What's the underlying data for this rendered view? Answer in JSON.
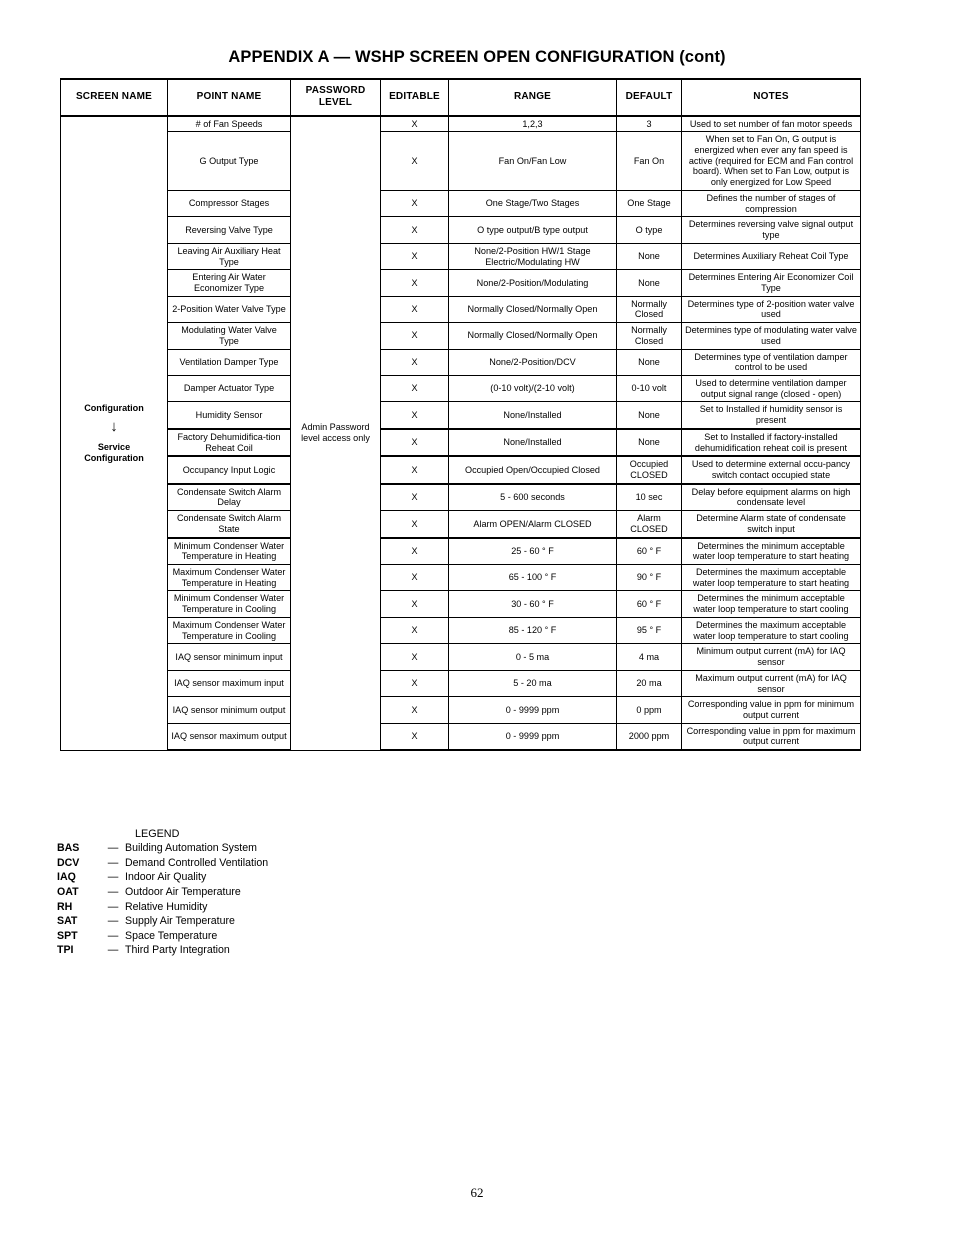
{
  "document": {
    "title": "APPENDIX A — WSHP SCREEN OPEN CONFIGURATION (cont)",
    "page_number": "62"
  },
  "table": {
    "headers": [
      "SCREEN NAME",
      "POINT NAME",
      "PASSWORD LEVEL",
      "EDITABLE",
      "RANGE",
      "DEFAULT",
      "NOTES"
    ],
    "header_password_line1": "PASSWORD",
    "header_password_line2": "LEVEL",
    "screen_name": {
      "line1": "Configuration",
      "arrow": "↓",
      "line2": "Service",
      "line3": "Configuration"
    },
    "password_level": "Admin Password level access only",
    "rows": [
      {
        "point_name": "# of Fan Speeds",
        "editable": "X",
        "range": "1,2,3",
        "default": "3",
        "notes": "Used to set number of fan motor speeds",
        "section_top": false
      },
      {
        "point_name": "G Output Type",
        "editable": "X",
        "range": "Fan On/Fan Low",
        "default": "Fan On",
        "notes": "When set to Fan On, G output is energized when ever any fan speed is active (required for ECM and Fan control board). When set to Fan Low, output is only energized for Low Speed",
        "section_top": false
      },
      {
        "point_name": "Compressor Stages",
        "editable": "X",
        "range": "One Stage/Two Stages",
        "default": "One Stage",
        "notes": "Defines the number of stages of compression",
        "section_top": false
      },
      {
        "point_name": "Reversing Valve Type",
        "editable": "X",
        "range": "O type output/B type output",
        "default": "O type",
        "notes": "Determines reversing valve signal output type",
        "section_top": false
      },
      {
        "point_name": "Leaving Air Auxiliary Heat Type",
        "editable": "X",
        "range": "None/2-Position HW/1 Stage Electric/Modulating HW",
        "default": "None",
        "notes": "Determines Auxiliary Reheat Coil Type",
        "section_top": false
      },
      {
        "point_name": "Entering Air Water Economizer Type",
        "editable": "X",
        "range": "None/2-Position/Modulating",
        "default": "None",
        "notes": "Determines Entering Air Economizer Coil Type",
        "section_top": false
      },
      {
        "point_name": "2-Position Water Valve Type",
        "editable": "X",
        "range": "Normally Closed/Normally Open",
        "default": "Normally Closed",
        "notes": "Determines type of 2-position water valve used",
        "section_top": false
      },
      {
        "point_name": "Modulating Water Valve Type",
        "editable": "X",
        "range": "Normally Closed/Normally Open",
        "default": "Normally Closed",
        "notes": "Determines type of modulating water valve used",
        "section_top": false
      },
      {
        "point_name": "Ventilation Damper Type",
        "editable": "X",
        "range": "None/2-Position/DCV",
        "default": "None",
        "notes": "Determines type of ventilation damper control to be used",
        "section_top": false
      },
      {
        "point_name": "Damper Actuator Type",
        "editable": "X",
        "range": "(0-10 volt)/(2-10 volt)",
        "default": "0-10 volt",
        "notes": "Used to determine ventilation damper output signal range (closed - open)",
        "section_top": false
      },
      {
        "point_name": "Humidity Sensor",
        "editable": "X",
        "range": "None/Installed",
        "default": "None",
        "notes": "Set to Installed if humidity sensor is present",
        "section_top": false
      },
      {
        "point_name": "Factory Dehumidifica-tion Reheat Coil",
        "editable": "X",
        "range": "None/Installed",
        "default": "None",
        "notes": "Set to Installed if factory-installed dehumidification reheat coil is present",
        "section_top": true
      },
      {
        "point_name": "Occupancy Input Logic",
        "editable": "X",
        "range": "Occupied Open/Occupied Closed",
        "default": "Occupied CLOSED",
        "notes": "Used to determine external occu-pancy switch contact occupied state",
        "section_top": true
      },
      {
        "point_name": "Condensate Switch Alarm Delay",
        "editable": "X",
        "range": "5 - 600 seconds",
        "default": "10 sec",
        "notes": "Delay before equipment alarms on high condensate level",
        "section_top": true
      },
      {
        "point_name": "Condensate Switch Alarm State",
        "editable": "X",
        "range": "Alarm OPEN/Alarm CLOSED",
        "default": "Alarm CLOSED",
        "notes": "Determine Alarm state of condensate switch input",
        "section_top": false
      },
      {
        "point_name": "Minimum Condenser Water Temperature in Heating",
        "editable": "X",
        "range": "25 - 60 ° F",
        "default": "60 ° F",
        "notes": "Determines the minimum acceptable water loop temperature to start heating",
        "section_top": true
      },
      {
        "point_name": "Maximum Condenser Water Temperature in Heating",
        "editable": "X",
        "range": "65 - 100 ° F",
        "default": "90 ° F",
        "notes": "Determines the maximum acceptable water loop temperature to start heating",
        "section_top": false
      },
      {
        "point_name": "Minimum Condenser Water Temperature in Cooling",
        "editable": "X",
        "range": "30 - 60 ° F",
        "default": "60 ° F",
        "notes": "Determines the minimum acceptable water loop temperature to start cooling",
        "section_top": false
      },
      {
        "point_name": "Maximum Condenser Water Temperature in Cooling",
        "editable": "X",
        "range": "85 - 120 ° F",
        "default": "95 ° F",
        "notes": "Determines the maximum acceptable water loop temperature to start cooling",
        "section_top": false
      },
      {
        "point_name": "IAQ sensor minimum input",
        "editable": "X",
        "range": "0 - 5 ma",
        "default": "4 ma",
        "notes": "Minimum output current (mA) for IAQ sensor",
        "section_top": false
      },
      {
        "point_name": "IAQ sensor maximum input",
        "editable": "X",
        "range": "5 - 20 ma",
        "default": "20 ma",
        "notes": "Maximum output current (mA) for IAQ sensor",
        "section_top": false
      },
      {
        "point_name": "IAQ sensor minimum output",
        "editable": "X",
        "range": "0 - 9999 ppm",
        "default": "0 ppm",
        "notes": "Corresponding value in ppm for minimum output current",
        "section_top": false
      },
      {
        "point_name": "IAQ sensor maximum output",
        "editable": "X",
        "range": "0 - 9999 ppm",
        "default": "2000 ppm",
        "notes": "Corresponding value in ppm for maximum output current",
        "section_top": false
      }
    ]
  },
  "legend": {
    "title": "LEGEND",
    "dash": "—",
    "entries": [
      {
        "abbr": "BAS",
        "term": "Building Automation System"
      },
      {
        "abbr": "DCV",
        "term": "Demand Controlled Ventilation"
      },
      {
        "abbr": "IAQ",
        "term": "Indoor Air Quality"
      },
      {
        "abbr": "OAT",
        "term": "Outdoor Air Temperature"
      },
      {
        "abbr": "RH",
        "term": "Relative Humidity"
      },
      {
        "abbr": "SAT",
        "term": "Supply Air Temperature"
      },
      {
        "abbr": "SPT",
        "term": "Space Temperature"
      },
      {
        "abbr": "TPI",
        "term": "Third Party Integration"
      }
    ]
  }
}
